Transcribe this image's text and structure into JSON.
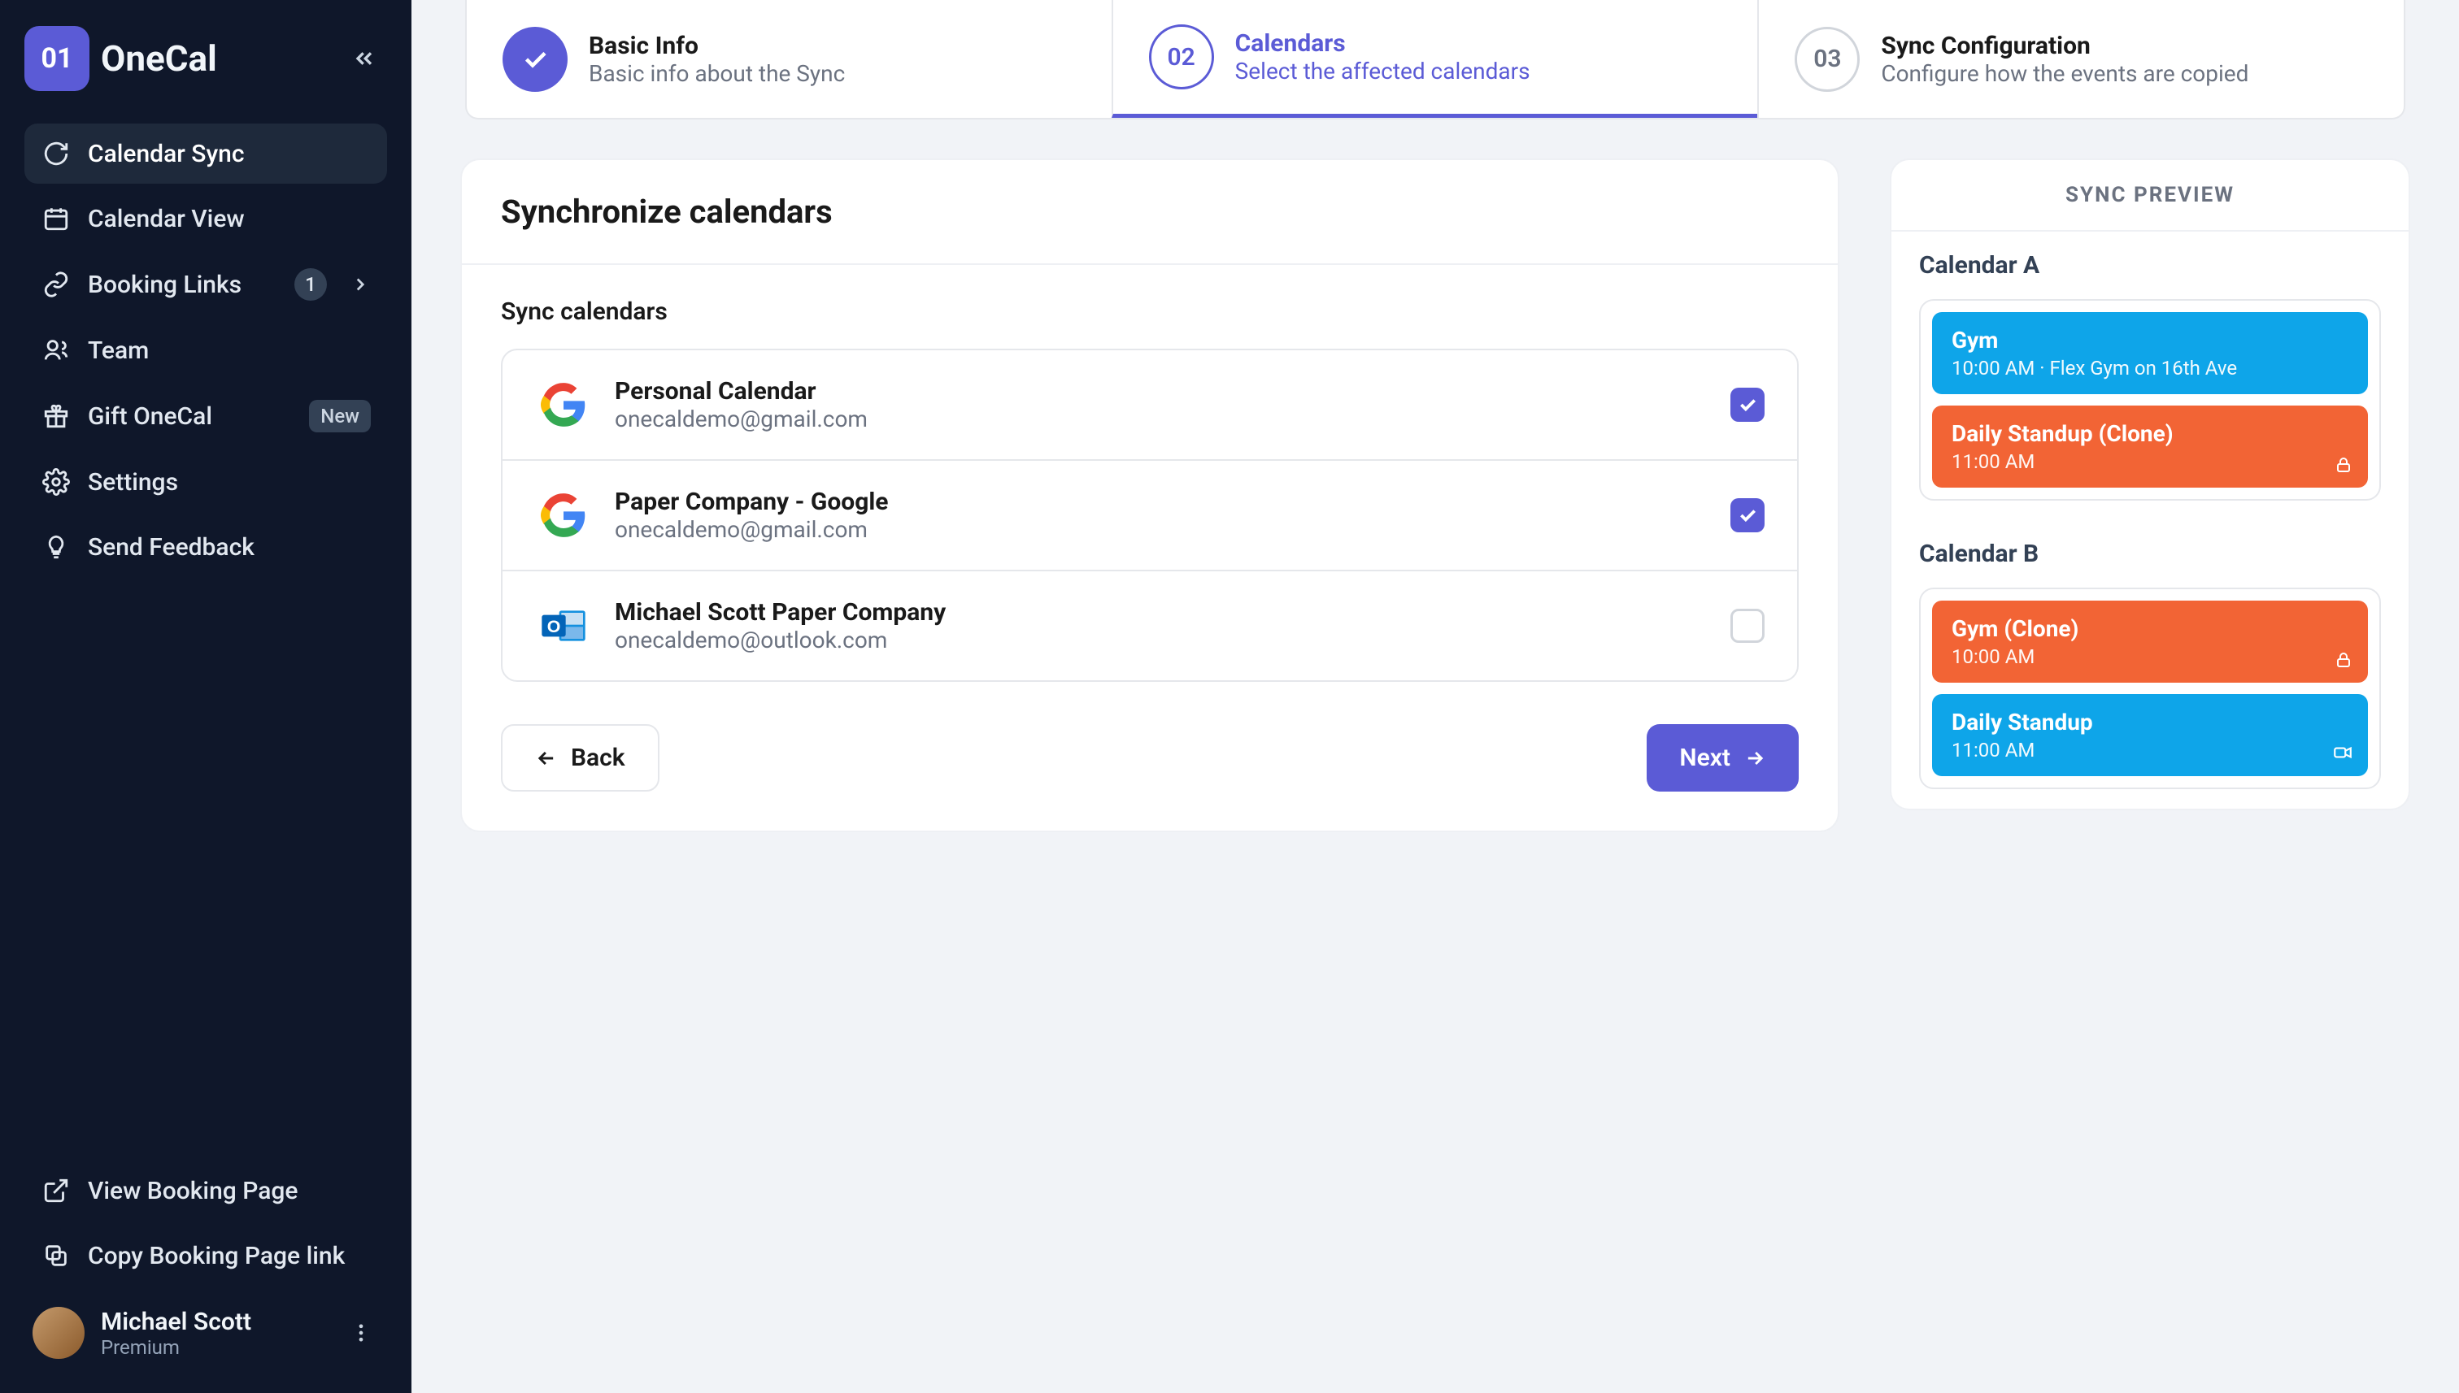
{
  "brand": {
    "mark": "01",
    "name": "OneCal"
  },
  "sidebar": {
    "items": [
      {
        "label": "Calendar Sync"
      },
      {
        "label": "Calendar View"
      },
      {
        "label": "Booking Links",
        "badge_count": "1"
      },
      {
        "label": "Team"
      },
      {
        "label": "Gift OneCal",
        "badge_new": "New"
      },
      {
        "label": "Settings"
      },
      {
        "label": "Send Feedback"
      }
    ],
    "bottom": [
      {
        "label": "View Booking Page"
      },
      {
        "label": "Copy Booking Page link"
      }
    ],
    "user": {
      "name": "Michael Scott",
      "plan": "Premium"
    }
  },
  "stepper": [
    {
      "num": "",
      "title": "Basic Info",
      "sub": "Basic info about the Sync",
      "state": "done"
    },
    {
      "num": "02",
      "title": "Calendars",
      "sub": "Select the affected calendars",
      "state": "active"
    },
    {
      "num": "03",
      "title": "Sync Configuration",
      "sub": "Configure how the events are copied",
      "state": "inactive"
    }
  ],
  "main_card": {
    "title": "Synchronize calendars",
    "section_label": "Sync calendars",
    "calendars": [
      {
        "name": "Personal Calendar",
        "email": "onecaldemo@gmail.com",
        "provider": "google",
        "checked": true
      },
      {
        "name": "Paper Company - Google",
        "email": "onecaldemo@gmail.com",
        "provider": "google",
        "checked": true
      },
      {
        "name": "Michael Scott Paper Company",
        "email": "onecaldemo@outlook.com",
        "provider": "outlook",
        "checked": false
      }
    ],
    "back_label": "Back",
    "next_label": "Next"
  },
  "preview": {
    "header": "SYNC PREVIEW",
    "sections": [
      {
        "title": "Calendar A",
        "events": [
          {
            "title": "Gym",
            "meta": "10:00 AM · Flex Gym on 16th Ave",
            "color": "blue",
            "icon": ""
          },
          {
            "title": "Daily Standup (Clone)",
            "meta": "11:00 AM",
            "color": "orange",
            "icon": "lock"
          }
        ]
      },
      {
        "title": "Calendar B",
        "events": [
          {
            "title": "Gym (Clone)",
            "meta": "10:00 AM",
            "color": "orange",
            "icon": "lock"
          },
          {
            "title": "Daily Standup",
            "meta": "11:00 AM",
            "color": "blue",
            "icon": "video"
          }
        ]
      }
    ]
  }
}
